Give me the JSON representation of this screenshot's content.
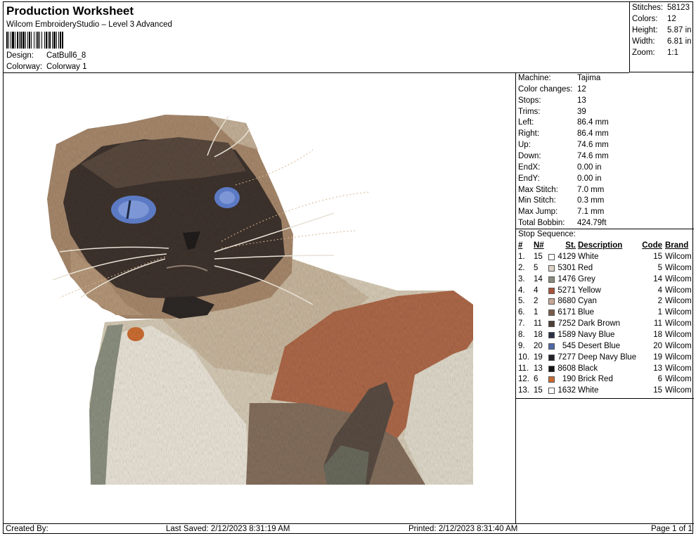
{
  "header": {
    "title": "Production Worksheet",
    "subtitle": "Wilcom EmbroideryStudio – Level 3 Advanced",
    "design_label": "Design:",
    "design_value": "CatBull6_8",
    "colorway_label": "Colorway:",
    "colorway_value": "Colorway 1"
  },
  "stats": [
    {
      "label": "Stitches:",
      "value": "58123"
    },
    {
      "label": "Colors:",
      "value": "12"
    },
    {
      "label": "Height:",
      "value": "5.87 in"
    },
    {
      "label": "Width:",
      "value": "6.81 in"
    },
    {
      "label": "Zoom:",
      "value": "1:1"
    }
  ],
  "machine_info": [
    {
      "label": "Machine:",
      "value": "Tajima"
    },
    {
      "label": "Color changes:",
      "value": "12"
    },
    {
      "label": "Stops:",
      "value": "13"
    },
    {
      "label": "Trims:",
      "value": "39"
    },
    {
      "label": "Left:",
      "value": "86.4 mm"
    },
    {
      "label": "Right:",
      "value": "86.4 mm"
    },
    {
      "label": "Up:",
      "value": "74.6 mm"
    },
    {
      "label": "Down:",
      "value": "74.6 mm"
    },
    {
      "label": "EndX:",
      "value": "0.00 in"
    },
    {
      "label": "EndY:",
      "value": "0.00 in"
    },
    {
      "label": "Max Stitch:",
      "value": "7.0 mm"
    },
    {
      "label": "Min Stitch:",
      "value": "0.3 mm"
    },
    {
      "label": "Max Jump:",
      "value": "7.1 mm"
    },
    {
      "label": "Total Bobbin:",
      "value": "424.79ft"
    }
  ],
  "stop_sequence": {
    "title": "Stop Sequence:",
    "headers": {
      "idx": "#",
      "n": "N#",
      "st": "St.",
      "desc": "Description",
      "code": "Code",
      "brand": "Brand"
    },
    "rows": [
      {
        "idx": "1.",
        "n": "15",
        "st": "4129",
        "desc": "White",
        "code": "15",
        "brand": "Wilcom",
        "color": "#ffffff"
      },
      {
        "idx": "2.",
        "n": "5",
        "st": "5301",
        "desc": "Red",
        "code": "5",
        "brand": "Wilcom",
        "color": "#dcd3c6"
      },
      {
        "idx": "3.",
        "n": "14",
        "st": "1476",
        "desc": "Grey",
        "code": "14",
        "brand": "Wilcom",
        "color": "#8d8a80"
      },
      {
        "idx": "4.",
        "n": "4",
        "st": "5271",
        "desc": "Yellow",
        "code": "4",
        "brand": "Wilcom",
        "color": "#a8533b"
      },
      {
        "idx": "5.",
        "n": "2",
        "st": "8680",
        "desc": "Cyan",
        "code": "2",
        "brand": "Wilcom",
        "color": "#c8a898"
      },
      {
        "idx": "6.",
        "n": "1",
        "st": "6171",
        "desc": "Blue",
        "code": "1",
        "brand": "Wilcom",
        "color": "#7a5c4a"
      },
      {
        "idx": "7.",
        "n": "11",
        "st": "7252",
        "desc": "Dark Brown",
        "code": "11",
        "brand": "Wilcom",
        "color": "#4e3e36"
      },
      {
        "idx": "8.",
        "n": "18",
        "st": "1589",
        "desc": "Navy Blue",
        "code": "18",
        "brand": "Wilcom",
        "color": "#2a2f45"
      },
      {
        "idx": "9.",
        "n": "20",
        "st": "545",
        "desc": "Desert Blue",
        "code": "20",
        "brand": "Wilcom",
        "color": "#4f6aa8"
      },
      {
        "idx": "10.",
        "n": "19",
        "st": "7277",
        "desc": "Deep Navy Blue",
        "code": "19",
        "brand": "Wilcom",
        "color": "#222228"
      },
      {
        "idx": "11.",
        "n": "13",
        "st": "8608",
        "desc": "Black",
        "code": "13",
        "brand": "Wilcom",
        "color": "#141414"
      },
      {
        "idx": "12.",
        "n": "6",
        "st": "190",
        "desc": "Brick Red",
        "code": "6",
        "brand": "Wilcom",
        "color": "#c86a30"
      },
      {
        "idx": "13.",
        "n": "15",
        "st": "1632",
        "desc": "White",
        "code": "15",
        "brand": "Wilcom",
        "color": "#ffffff"
      }
    ]
  },
  "footer": {
    "created_by": "Created By:",
    "last_saved": "Last Saved: 2/12/2023 8:31:19 AM",
    "printed": "Printed: 2/12/2023 8:31:40 AM",
    "page": "Page 1 of 1"
  }
}
